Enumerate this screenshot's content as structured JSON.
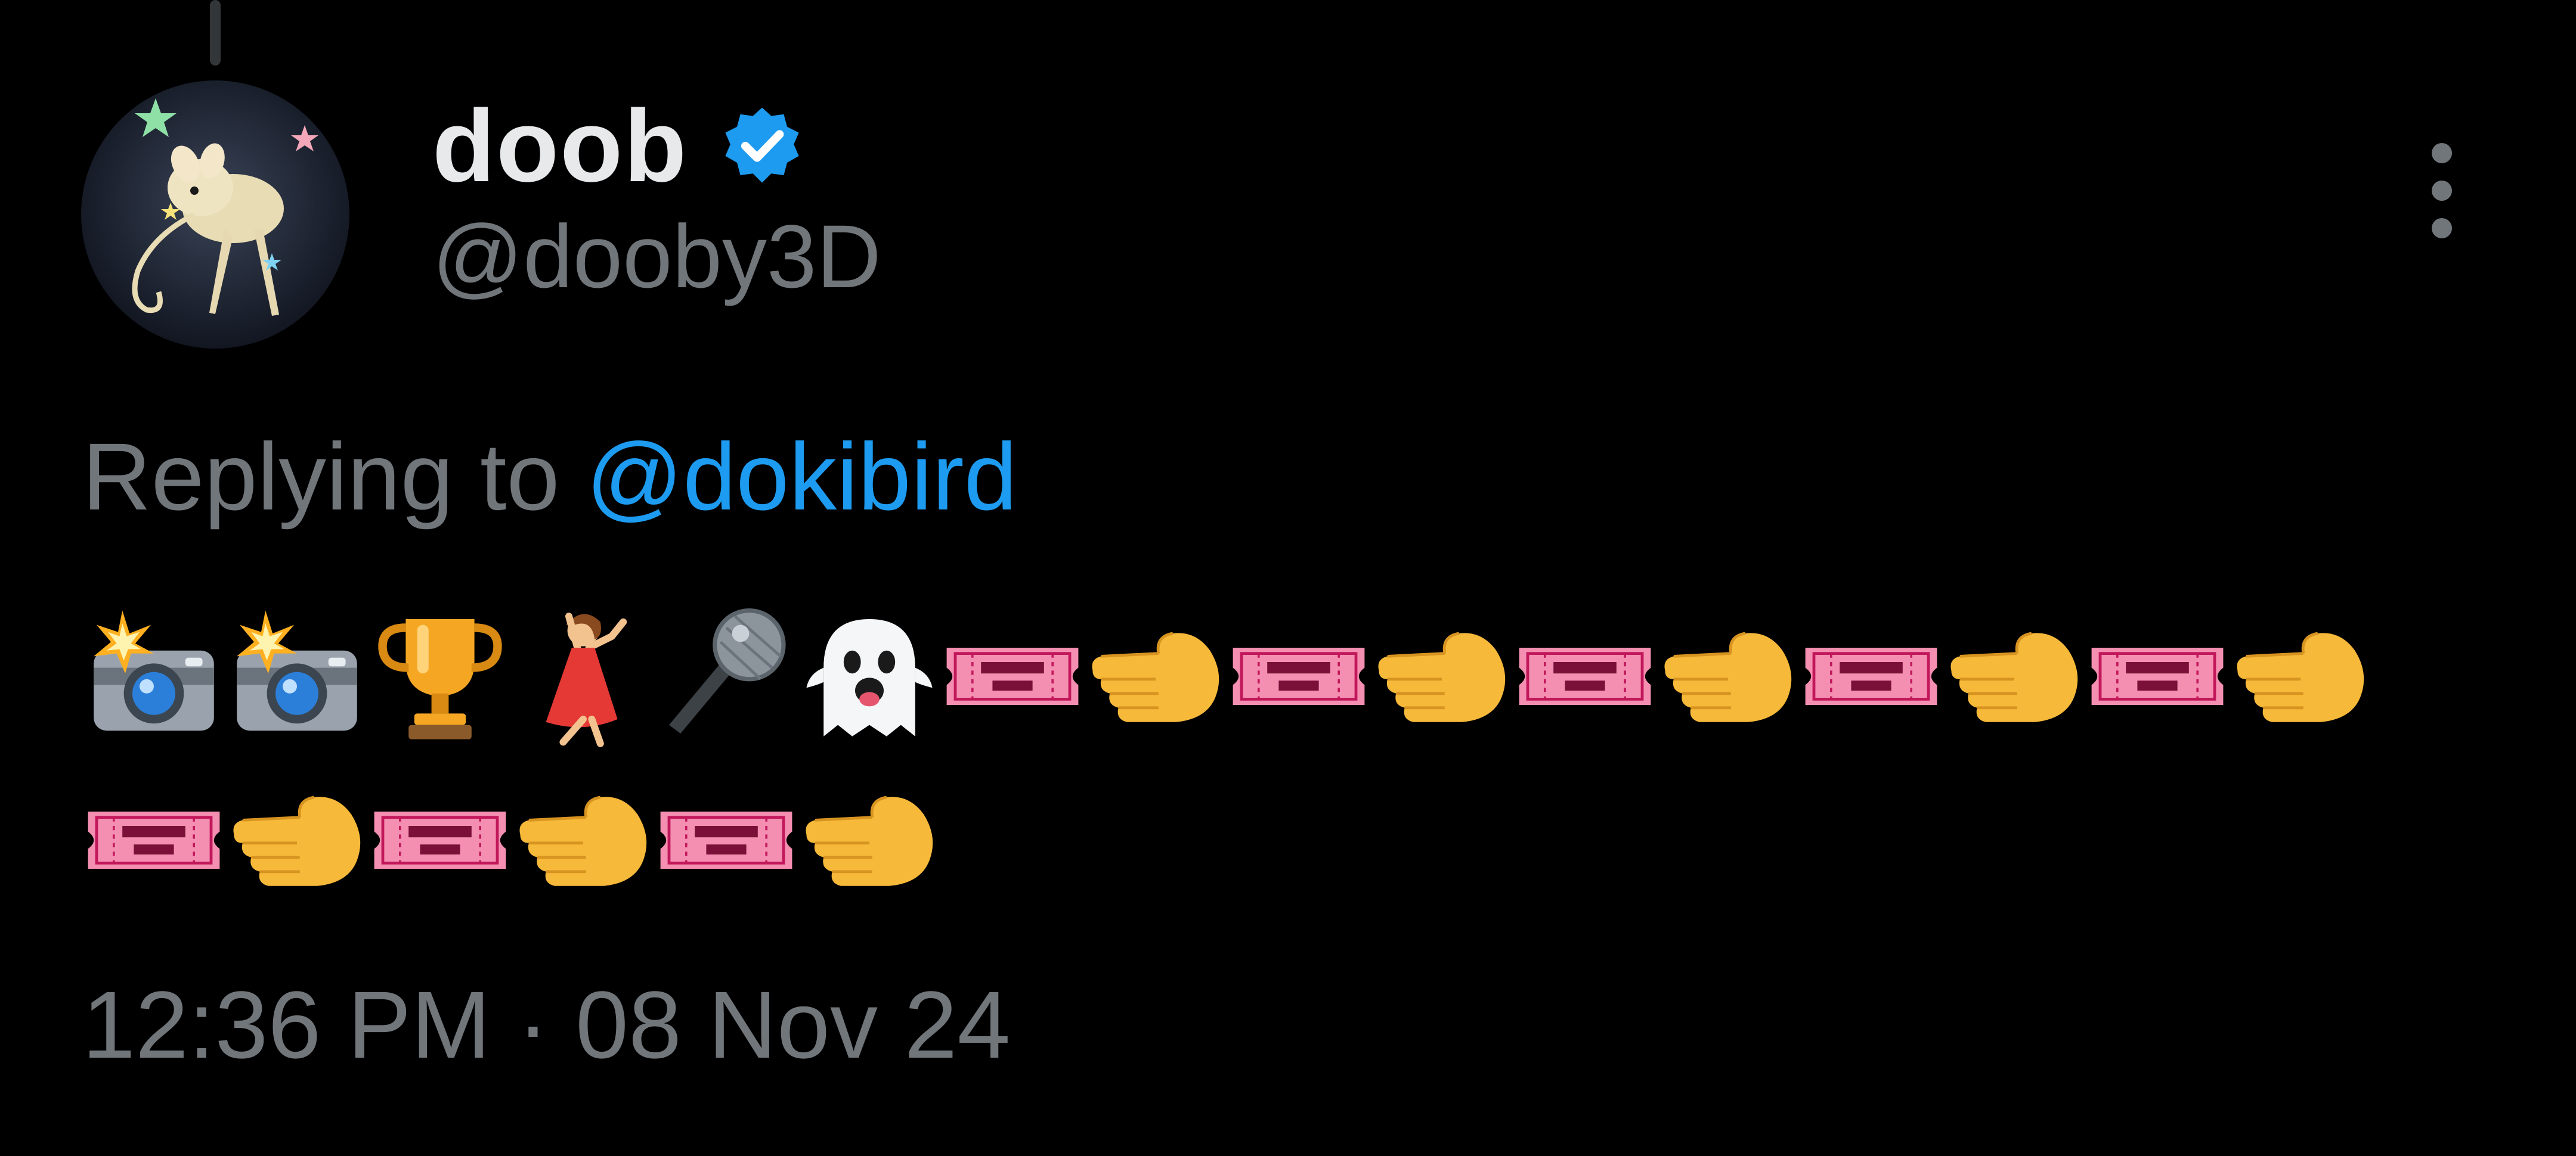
{
  "tweet": {
    "display_name": "doob",
    "handle": "@dooby3D",
    "verified": true,
    "reply_prefix": "Replying to",
    "reply_mention": "@dokibird",
    "emoji_rows": [
      [
        "camera-flash",
        "camera-flash",
        "trophy",
        "dancer",
        "microphone",
        "ghost",
        "ticket",
        "hand",
        "ticket",
        "hand",
        "ticket",
        "hand",
        "ticket",
        "hand",
        "ticket",
        "hand"
      ],
      [
        "ticket",
        "hand",
        "ticket",
        "hand",
        "ticket",
        "hand"
      ]
    ],
    "timestamp": "12:36 PM · 08 Nov 24"
  },
  "icons": {
    "verified_badge": "verified-badge-icon",
    "more": "more-options-icon"
  },
  "colors": {
    "background": "#000000",
    "name": "#e7e9ea",
    "secondary": "#71767b",
    "accent": "#1d9bf0",
    "ticket": "#f48fb1",
    "hand": "#f7b93a"
  }
}
